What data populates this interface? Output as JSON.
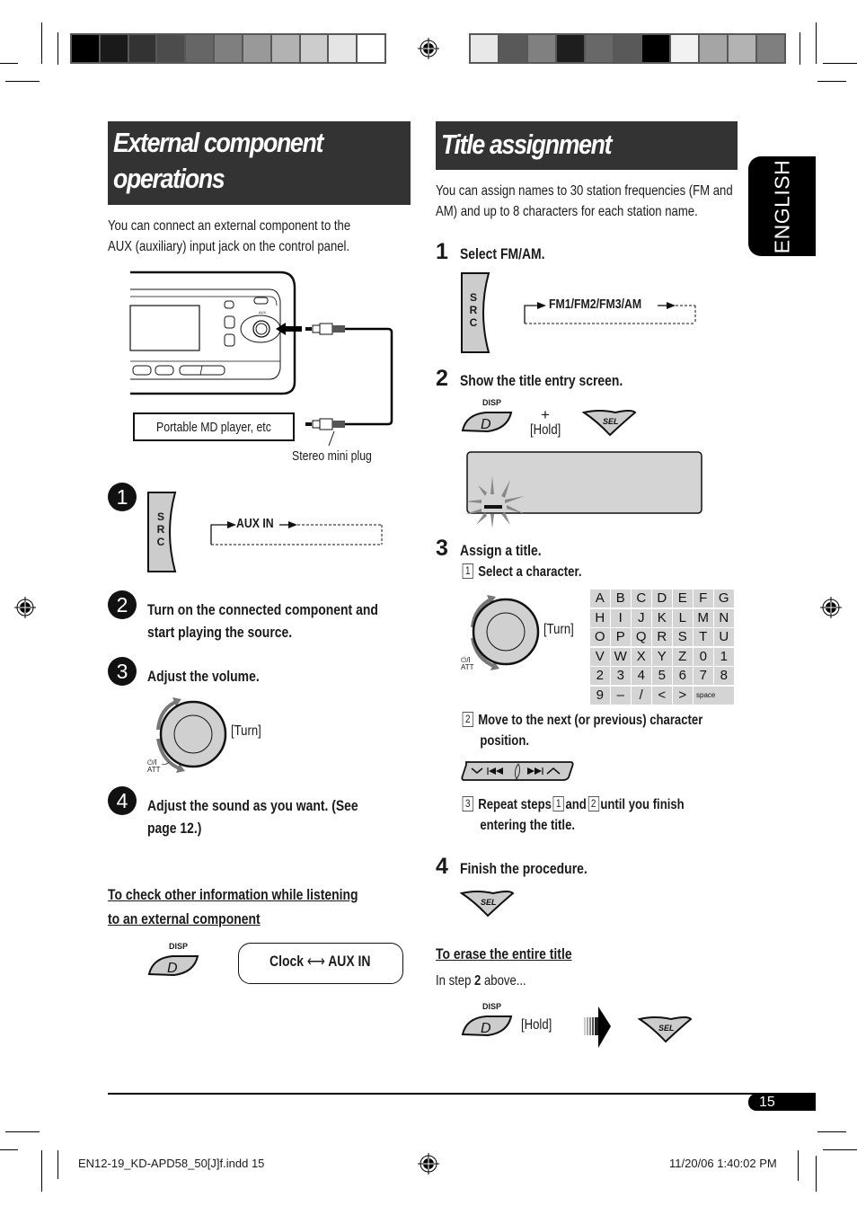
{
  "print_marks": {
    "left_bar_colors": [
      "#000000",
      "#1a1a1a",
      "#333333",
      "#4c4c4c",
      "#666666",
      "#7f7f7f",
      "#999999",
      "#b2b2b2",
      "#cccccc",
      "#e5e5e5",
      "#ffffff"
    ],
    "right_bar_colors": [
      "#e8e8e8",
      "#595959",
      "#808080",
      "#1e1e1e",
      "#686868",
      "#595959",
      "#000000",
      "#f2f2f2",
      "#a5a5a5",
      "#b3b3b3",
      "#7f7f7f"
    ]
  },
  "left": {
    "title_line1": "External component",
    "title_line2": "operations",
    "intro_line1": "You can connect an external component to the",
    "intro_line2": "AUX (auxiliary) input jack on the control panel.",
    "diagram": {
      "aux_label": "AUX",
      "device_label": "Portable MD player, etc",
      "plug_label": "Stereo mini plug"
    },
    "steps": [
      {
        "num": "1",
        "src_letters": [
          "S",
          "R",
          "C"
        ],
        "cycle_label": "AUX IN"
      },
      {
        "num": "2",
        "line1": "Turn on the connected component and",
        "line2": "start playing the source."
      },
      {
        "num": "3",
        "line1": "Adjust the volume.",
        "knob_label": "[Turn]",
        "power_label": "⏻/I",
        "att_label": "ATT"
      },
      {
        "num": "4",
        "line1": "Adjust the sound as you want. (See",
        "line2": "page 12.)"
      }
    ],
    "check_info": {
      "heading_line1": "To check other information while listening",
      "heading_line2": "to an external component",
      "disp_label": "DISP",
      "disp_key": "D",
      "toggle_left": "Clock",
      "toggle_right": "AUX IN"
    }
  },
  "right": {
    "title": "Title assignment",
    "intro_line1": "You can assign names to 30 station frequencies (FM and",
    "intro_line2": "AM) and up to 8 characters for each station name.",
    "step1": {
      "num": "1",
      "text": "Select FM/AM.",
      "src_letters": [
        "S",
        "R",
        "C"
      ],
      "cycle_label": "FM1/FM2/FM3/AM"
    },
    "step2": {
      "num": "2",
      "text": "Show the title entry screen.",
      "disp_label": "DISP",
      "disp_key": "D",
      "plus": "+",
      "hold_label": "[Hold]",
      "sel_key": "SEL"
    },
    "step3": {
      "num": "3",
      "text": "Assign a title.",
      "sub1": {
        "num": "1",
        "text": "Select a character.",
        "knob_label": "[Turn]",
        "power_label": "⏻/I",
        "att_label": "ATT"
      },
      "characters": [
        "A",
        "B",
        "C",
        "D",
        "E",
        "F",
        "G",
        "H",
        "I",
        "J",
        "K",
        "L",
        "M",
        "N",
        "O",
        "P",
        "Q",
        "R",
        "S",
        "T",
        "U",
        "V",
        "W",
        "X",
        "Y",
        "Z",
        "0",
        "1",
        "2",
        "3",
        "4",
        "5",
        "6",
        "7",
        "8",
        "9",
        "–",
        "/",
        "<",
        ">",
        "space"
      ],
      "sub2": {
        "num": "2",
        "line1": "Move to the next (or previous) character",
        "line2": "position."
      },
      "sub3": {
        "num": "3",
        "line1_a": "Repeat steps",
        "ref1": "1",
        "line1_b": "and",
        "ref2": "2",
        "line1_c": "until you finish",
        "line2": "entering the title."
      }
    },
    "step4": {
      "num": "4",
      "text": "Finish the procedure.",
      "sel_key": "SEL"
    },
    "erase": {
      "heading": "To erase the entire title",
      "text_a": "In step",
      "text_b": "2",
      "text_c": "above...",
      "disp_label": "DISP",
      "disp_key": "D",
      "hold_label": "[Hold]",
      "sel_key": "SEL"
    }
  },
  "language_tab": "ENGLISH",
  "page_number": "15",
  "footer": {
    "file": "EN12-19_KD-APD58_50[J]f.indd   15",
    "timestamp": "11/20/06   1:40:02 PM"
  }
}
